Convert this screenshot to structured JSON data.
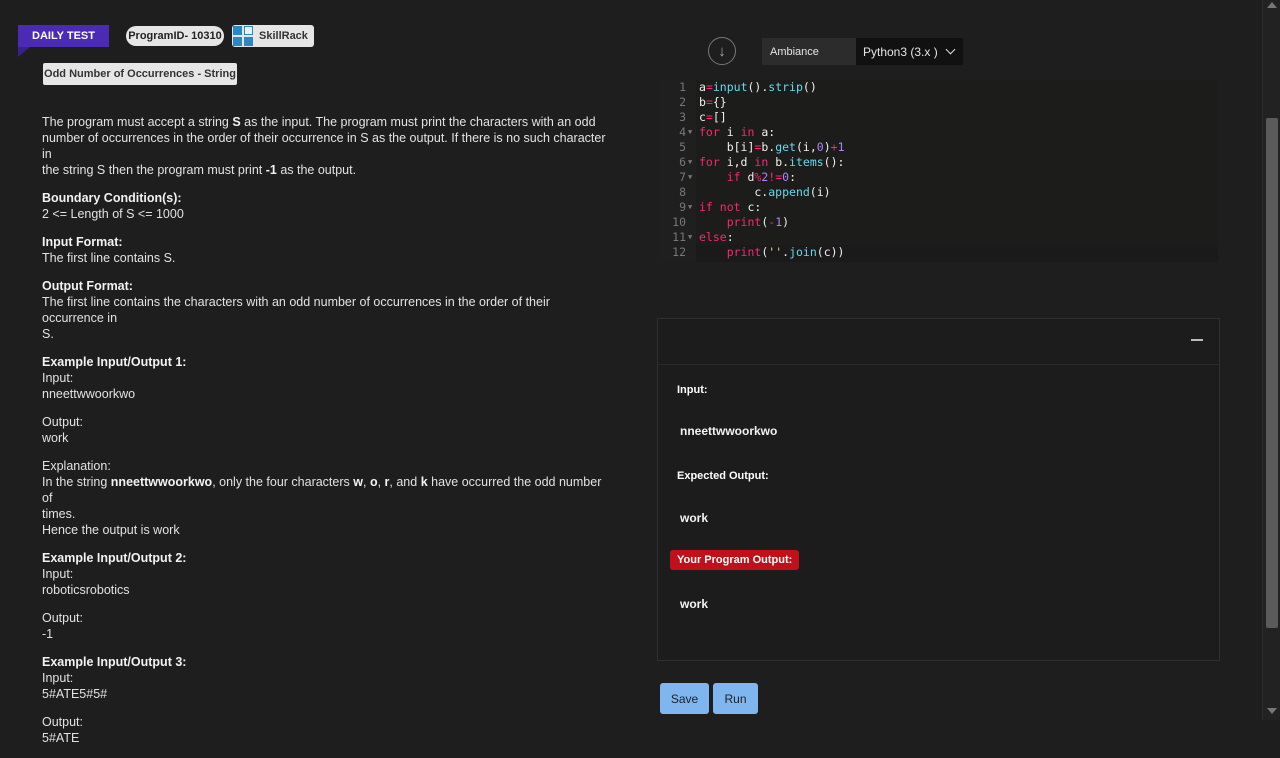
{
  "header": {
    "daily_test": "DAILY TEST",
    "program_id": "ProgramID- 10310",
    "brand": "SkillRack",
    "problem_title": "Odd Number of Occurrences - String"
  },
  "description": {
    "intro_a": "The program must accept a string ",
    "intro_s": "S",
    "intro_b": " as the input. The program must print the characters with an odd",
    "intro_c": "number of occurrences in the order of their occurrence in S as the output. If there is no such character in",
    "intro_d": "the string S then the program must print ",
    "intro_neg": "-1",
    "intro_e": " as the output.",
    "boundary_heading": "Boundary Condition(s):",
    "boundary_text": "2 <= Length of S <= 1000",
    "input_heading": "Input Format:",
    "input_text": "The first line contains S.",
    "output_heading": "Output Format:",
    "output_text_1": "The first line contains the characters with an odd number of occurrences in the order of their occurrence in",
    "output_text_2": "S.",
    "ex1_heading": "Example Input/Output 1:",
    "ex1_input_label": "Input:",
    "ex1_input": "nneettwwoorkwo",
    "ex1_output_label": "Output:",
    "ex1_output": "work",
    "explanation_label": "Explanation:",
    "expl_a": "In the string ",
    "expl_str": "nneettwwoorkwo",
    "expl_b": ", only the four characters ",
    "expl_w": "w",
    "expl_c1": ", ",
    "expl_o": "o",
    "expl_c2": ", ",
    "expl_r": "r",
    "expl_and": ", and ",
    "expl_k": "k",
    "expl_c": " have occurred the odd number of",
    "expl_d": "times.",
    "expl_e": "Hence the output is work",
    "ex2_heading": "Example Input/Output 2:",
    "ex2_input_label": "Input:",
    "ex2_input": "roboticsrobotics",
    "ex2_output_label": "Output:",
    "ex2_output": "-1",
    "ex3_heading": "Example Input/Output 3:",
    "ex3_input_label": "Input:",
    "ex3_input": "5#ATE5#5#",
    "ex3_output_label": "Output:",
    "ex3_output": "5#ATE"
  },
  "toolbar": {
    "theme_label": "Ambiance",
    "language": "Python3 (3.x )"
  },
  "editor": {
    "line_numbers": [
      "1",
      "2",
      "3",
      "4",
      "5",
      "6",
      "7",
      "8",
      "9",
      "10",
      "11",
      "12"
    ],
    "code_lines": [
      "a=input().strip()",
      "b={}",
      "c=[]",
      "for i in a:",
      "    b[i]=b.get(i,0)+1",
      "for i,d in b.items():",
      "    if d%2!=0:",
      "        c.append(i)",
      "if not c:",
      "    print(-1)",
      "else:",
      "    print(''.join(c))"
    ]
  },
  "results": {
    "input_label": "Input:",
    "input_value": "nneettwwoorkwo",
    "expected_label": "Expected Output:",
    "expected_value": "work",
    "program_label": "Your Program Output:",
    "program_value": "work"
  },
  "actions": {
    "save_label": "Save",
    "run_label": "Run"
  },
  "colors": {
    "accent_purple": "#4b2bb5",
    "error_red": "#c0101a",
    "button_blue": "#7fb6f0"
  }
}
